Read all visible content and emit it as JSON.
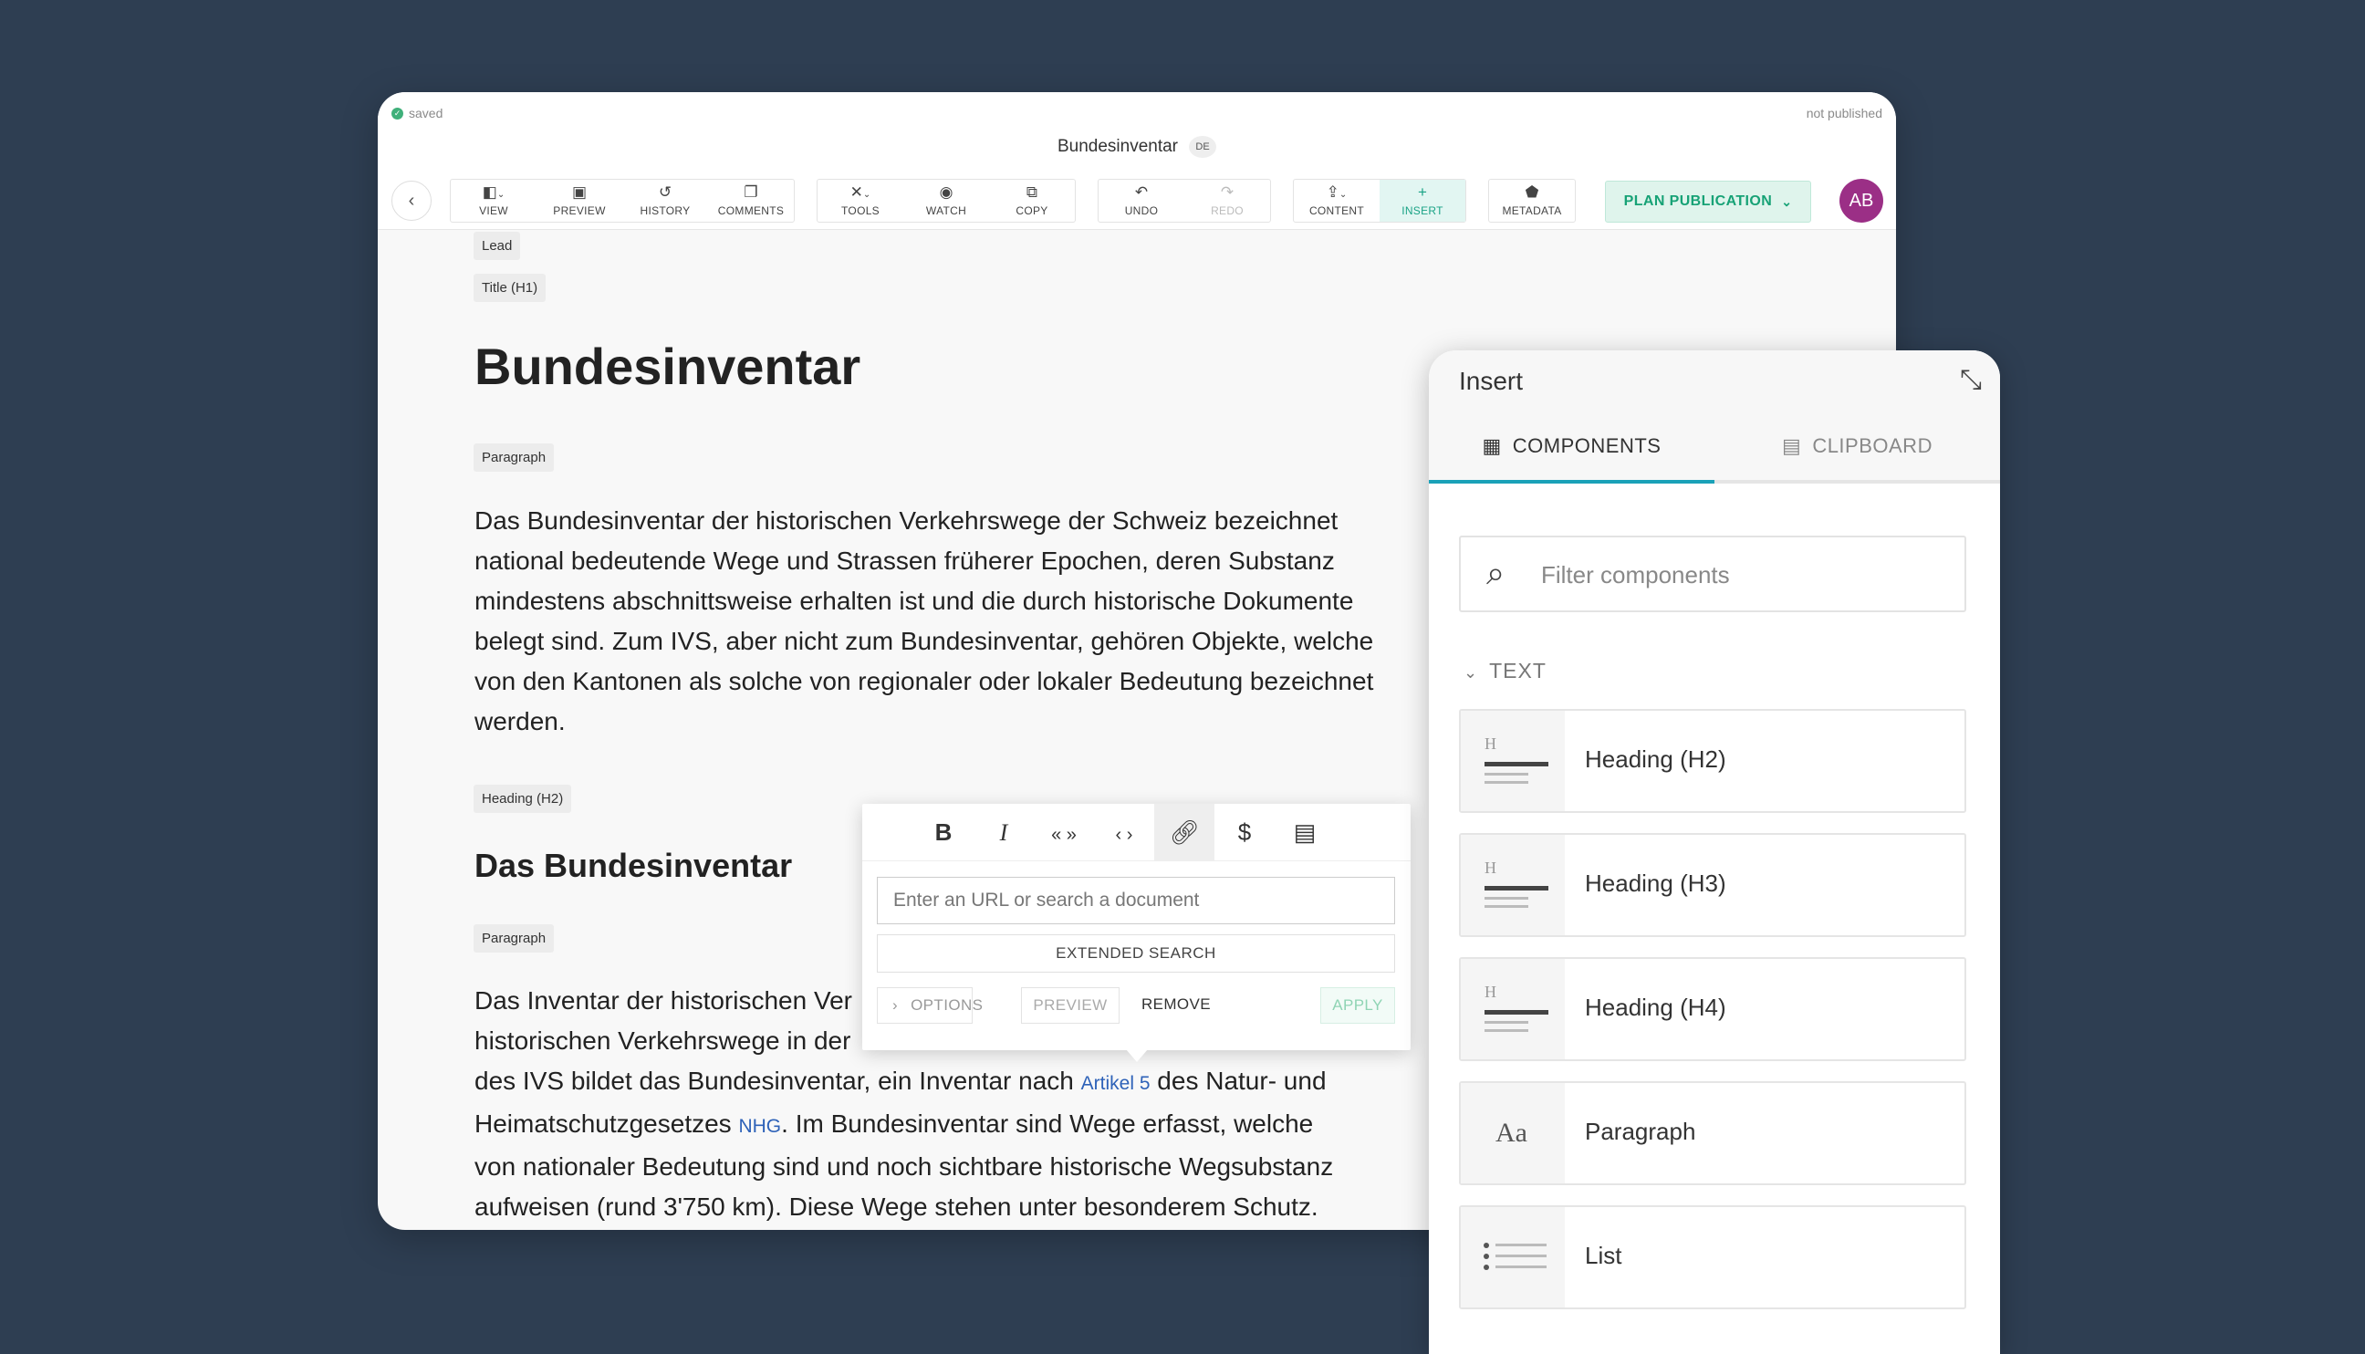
{
  "window": {
    "status_saved": "saved",
    "status_published": "not published",
    "doc_title": "Bundesinventar",
    "lang": "DE"
  },
  "toolbar": {
    "view": "VIEW",
    "preview": "PREVIEW",
    "history": "HISTORY",
    "comments": "COMMENTS",
    "tools": "TOOLS",
    "watch": "WATCH",
    "copy": "COPY",
    "undo": "UNDO",
    "redo": "REDO",
    "content": "CONTENT",
    "insert": "INSERT",
    "metadata": "METADATA",
    "plan_publication": "PLAN PUBLICATION",
    "avatar": "AB"
  },
  "document": {
    "tag_lead": "Lead",
    "tag_title": "Title (H1)",
    "title": "Bundesinventar",
    "tag_paragraph1": "Paragraph",
    "paragraph1": "Das Bundesinventar der historischen Verkehrswege der Schweiz bezeichnet national bedeutende Wege und Strassen früherer Epochen, deren Substanz mindestens abschnittsweise erhalten ist und die durch historische Dokumente belegt sind. Zum IVS, aber nicht zum Bundesinventar, gehören Objekte, welche von den Kantonen als solche von regionaler oder lokaler Bedeutung bezeichnet werden.",
    "tag_heading": "Heading (H2)",
    "heading": "Das Bundesinventar",
    "tag_paragraph2": "Paragraph",
    "paragraph2_part1": "Das Inventar der historischen Ver",
    "paragraph2_part2": "historischen Verkehrswege in der",
    "paragraph2_part3": "des IVS bildet das Bundesinventar, ein Inventar nach ",
    "paragraph2_link1": "Artikel 5",
    "paragraph2_part4": " des Natur- und",
    "paragraph2_part5": "Heimatschutzgesetzes ",
    "paragraph2_link2": "NHG",
    "paragraph2_part6": ". Im Bundesinventar sind Wege erfasst, welche",
    "paragraph2_part7": "von nationaler Bedeutung sind und noch sichtbare historische Wegsubstanz",
    "paragraph2_part8": "aufweisen (rund 3'750 km). Diese Wege stehen unter besonderem Schutz."
  },
  "link_popover": {
    "url_placeholder": "Enter an URL or search a document",
    "extended_search": "EXTENDED SEARCH",
    "options": "OPTIONS",
    "preview": "PREVIEW",
    "remove": "REMOVE",
    "apply": "APPLY"
  },
  "insert_panel": {
    "title": "Insert",
    "tab_components": "COMPONENTS",
    "tab_clipboard": "CLIPBOARD",
    "filter_placeholder": "Filter components",
    "section_text": "TEXT",
    "components": [
      {
        "label": "Heading (H2)",
        "icon": "heading-icon"
      },
      {
        "label": "Heading (H3)",
        "icon": "heading-icon"
      },
      {
        "label": "Heading (H4)",
        "icon": "heading-icon"
      },
      {
        "label": "Paragraph",
        "icon": "paragraph-icon"
      },
      {
        "label": "List",
        "icon": "list-icon"
      }
    ]
  },
  "colors": {
    "background": "#2e3e52",
    "accent_green": "#17a276",
    "tab_underline": "#1aa1b8",
    "avatar": "#9b2f86",
    "link": "#2e62b8"
  }
}
